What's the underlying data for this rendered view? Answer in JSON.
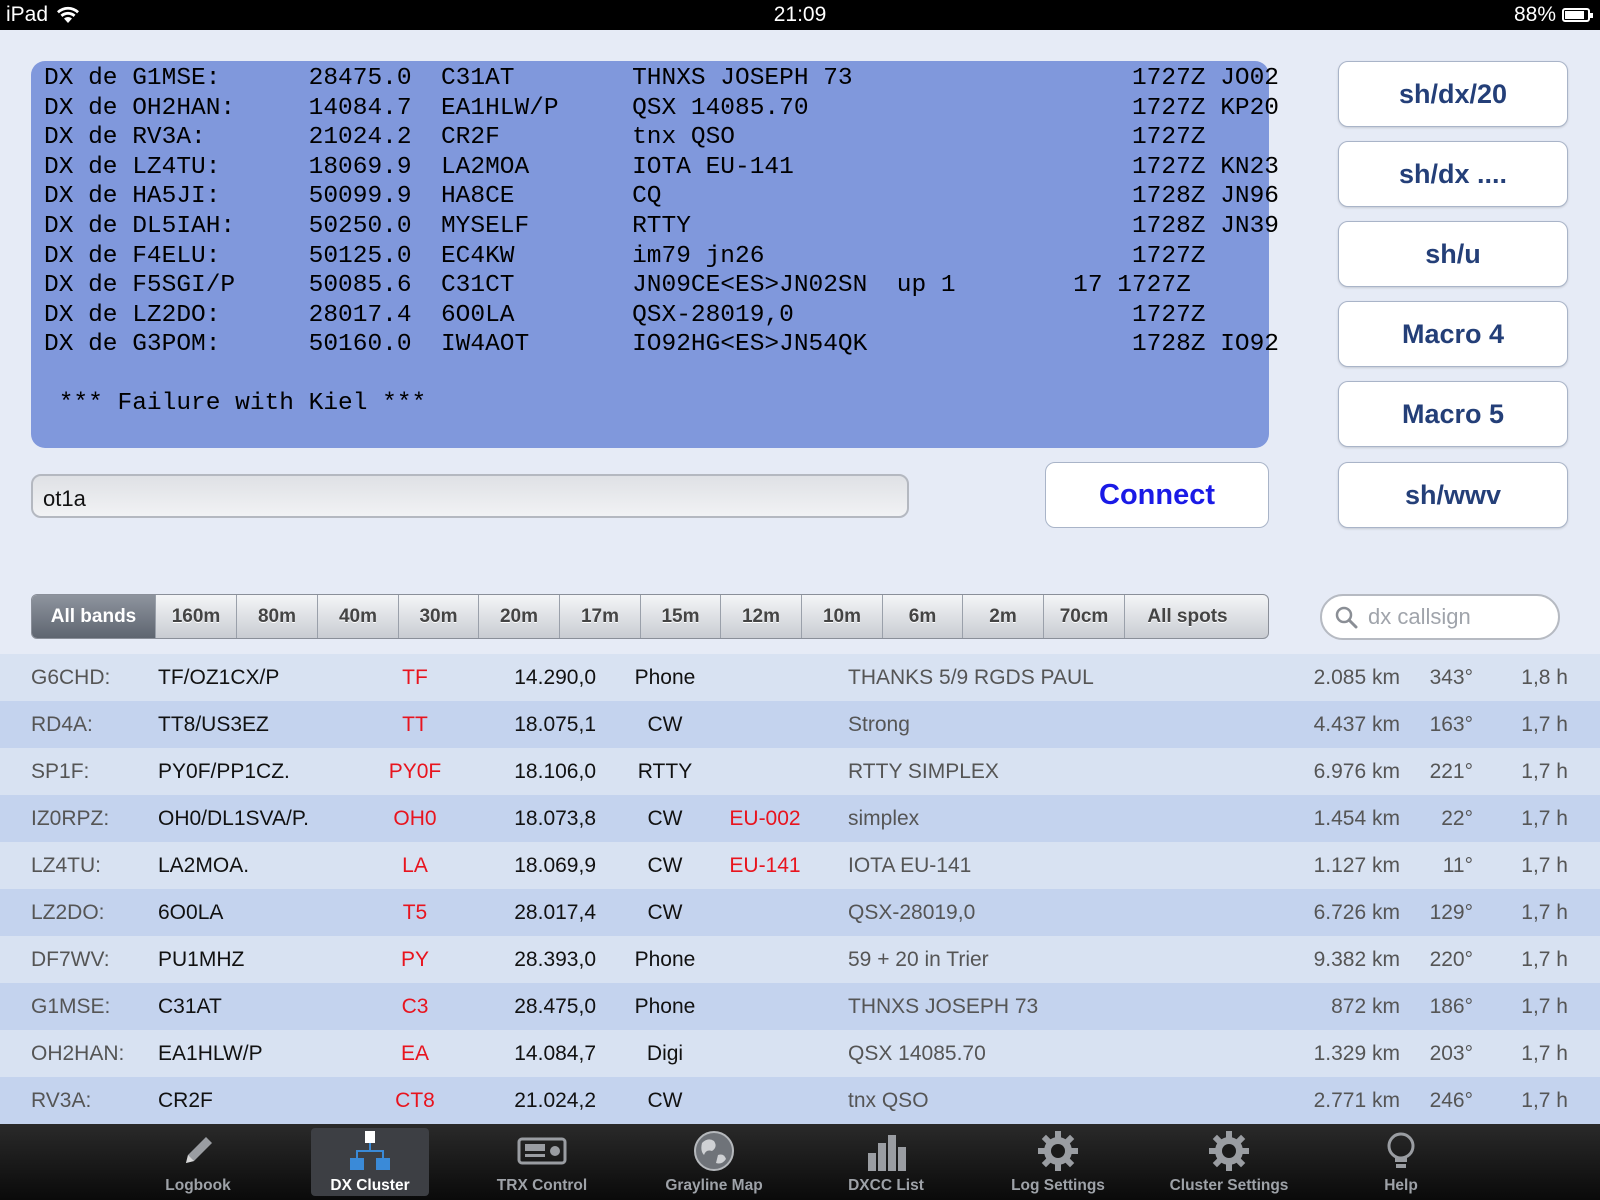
{
  "status_bar": {
    "device": "iPad",
    "time": "21:09",
    "battery": "88%",
    "battery_level": 0.88
  },
  "console": {
    "lines": [
      "DX de G1MSE:      28475.0  C31AT        THNXS JOSEPH 73                   1727Z JO02",
      "DX de OH2HAN:     14084.7  EA1HLW/P     QSX 14085.70                      1727Z KP20",
      "DX de RV3A:       21024.2  CR2F         tnx QSO                           1727Z",
      "DX de LZ4TU:      18069.9  LA2MOA       IOTA EU-141                       1727Z KN23",
      "DX de HA5JI:      50099.9  HA8CE        CQ                                1728Z JN96",
      "DX de DL5IAH:     50250.0  MYSELF       RTTY                              1728Z JN39",
      "DX de F4ELU:      50125.0  EC4KW        im79 jn26                         1727Z",
      "DX de F5SGI/P     50085.6  C31CT        JN09CE<ES>JN02SN  up 1        17 1727Z",
      "DX de LZ2DO:      28017.4  6O0LA        QSX-28019,0                       1727Z",
      "DX de G3POM:      50160.0  IW4AOT       IO92HG<ES>JN54QK                  1728Z IO92"
    ],
    "message": " *** Failure with Kiel ***"
  },
  "macros": [
    "sh/dx/20",
    "sh/dx ....",
    "sh/u",
    "Macro 4",
    "Macro 5",
    "sh/wwv"
  ],
  "command": {
    "value": "ot1a"
  },
  "connect_label": "Connect",
  "bands": {
    "items": [
      "All bands",
      "160m",
      "80m",
      "40m",
      "30m",
      "20m",
      "17m",
      "15m",
      "12m",
      "10m",
      "6m",
      "2m",
      "70cm",
      "All spots"
    ],
    "selected": "All bands"
  },
  "search": {
    "placeholder": "dx callsign"
  },
  "spots": [
    {
      "spotter": "G6CHD:",
      "call": "TF/OZ1CX/P",
      "prefix": "TF",
      "freq": "14.290,0",
      "mode": "Phone",
      "iota": "",
      "comment": "THANKS 5/9 RGDS PAUL",
      "distance": "2.085 km",
      "bearing": "343°",
      "age": "1,8 h"
    },
    {
      "spotter": "RD4A:",
      "call": "TT8/US3EZ",
      "prefix": "TT",
      "freq": "18.075,1",
      "mode": "CW",
      "iota": "",
      "comment": "Strong",
      "distance": "4.437 km",
      "bearing": "163°",
      "age": "1,7 h"
    },
    {
      "spotter": "SP1F:",
      "call": "PY0F/PP1CZ.",
      "prefix": "PY0F",
      "freq": "18.106,0",
      "mode": "RTTY",
      "iota": "",
      "comment": "RTTY SIMPLEX",
      "distance": "6.976 km",
      "bearing": "221°",
      "age": "1,7 h"
    },
    {
      "spotter": "IZ0RPZ:",
      "call": "OH0/DL1SVA/P.",
      "prefix": "OH0",
      "freq": "18.073,8",
      "mode": "CW",
      "iota": "EU-002",
      "comment": "simplex",
      "distance": "1.454 km",
      "bearing": "22°",
      "age": "1,7 h"
    },
    {
      "spotter": "LZ4TU:",
      "call": "LA2MOA.",
      "prefix": "LA",
      "freq": "18.069,9",
      "mode": "CW",
      "iota": "EU-141",
      "comment": "IOTA EU-141",
      "distance": "1.127 km",
      "bearing": "11°",
      "age": "1,7 h"
    },
    {
      "spotter": "LZ2DO:",
      "call": "6O0LA",
      "prefix": "T5",
      "freq": "28.017,4",
      "mode": "CW",
      "iota": "",
      "comment": "QSX-28019,0",
      "distance": "6.726 km",
      "bearing": "129°",
      "age": "1,7 h"
    },
    {
      "spotter": "DF7WV:",
      "call": "PU1MHZ",
      "prefix": "PY",
      "freq": "28.393,0",
      "mode": "Phone",
      "iota": "",
      "comment": "59 + 20 in Trier",
      "distance": "9.382 km",
      "bearing": "220°",
      "age": "1,7 h"
    },
    {
      "spotter": "G1MSE:",
      "call": "C31AT",
      "prefix": "C3",
      "freq": "28.475,0",
      "mode": "Phone",
      "iota": "",
      "comment": "THNXS JOSEPH 73",
      "distance": "872 km",
      "bearing": "186°",
      "age": "1,7 h"
    },
    {
      "spotter": "OH2HAN:",
      "call": "EA1HLW/P",
      "prefix": "EA",
      "freq": "14.084,7",
      "mode": "Digi",
      "iota": "",
      "comment": "QSX 14085.70",
      "distance": "1.329 km",
      "bearing": "203°",
      "age": "1,7 h"
    },
    {
      "spotter": "RV3A:",
      "call": "CR2F",
      "prefix": "CT8",
      "freq": "21.024,2",
      "mode": "CW",
      "iota": "",
      "comment": "tnx QSO",
      "distance": "2.771 km",
      "bearing": "246°",
      "age": "1,7 h"
    }
  ],
  "tabs": [
    {
      "label": "Logbook",
      "icon": "pencil-icon"
    },
    {
      "label": "DX Cluster",
      "icon": "cluster-network-icon",
      "active": true
    },
    {
      "label": "TRX Control",
      "icon": "radio-icon"
    },
    {
      "label": "Grayline Map",
      "icon": "globe-icon"
    },
    {
      "label": "DXCC List",
      "icon": "bar-chart-icon"
    },
    {
      "label": "Log Settings",
      "icon": "gear-icon"
    },
    {
      "label": "Cluster Settings",
      "icon": "gear-icon"
    },
    {
      "label": "Help",
      "icon": "lightbulb-icon"
    }
  ],
  "colors": {
    "console_bg": "#8098dc",
    "prefix_red": "#e8141e",
    "connect_blue": "#1a1ae6",
    "macro_text": "#243f78"
  }
}
